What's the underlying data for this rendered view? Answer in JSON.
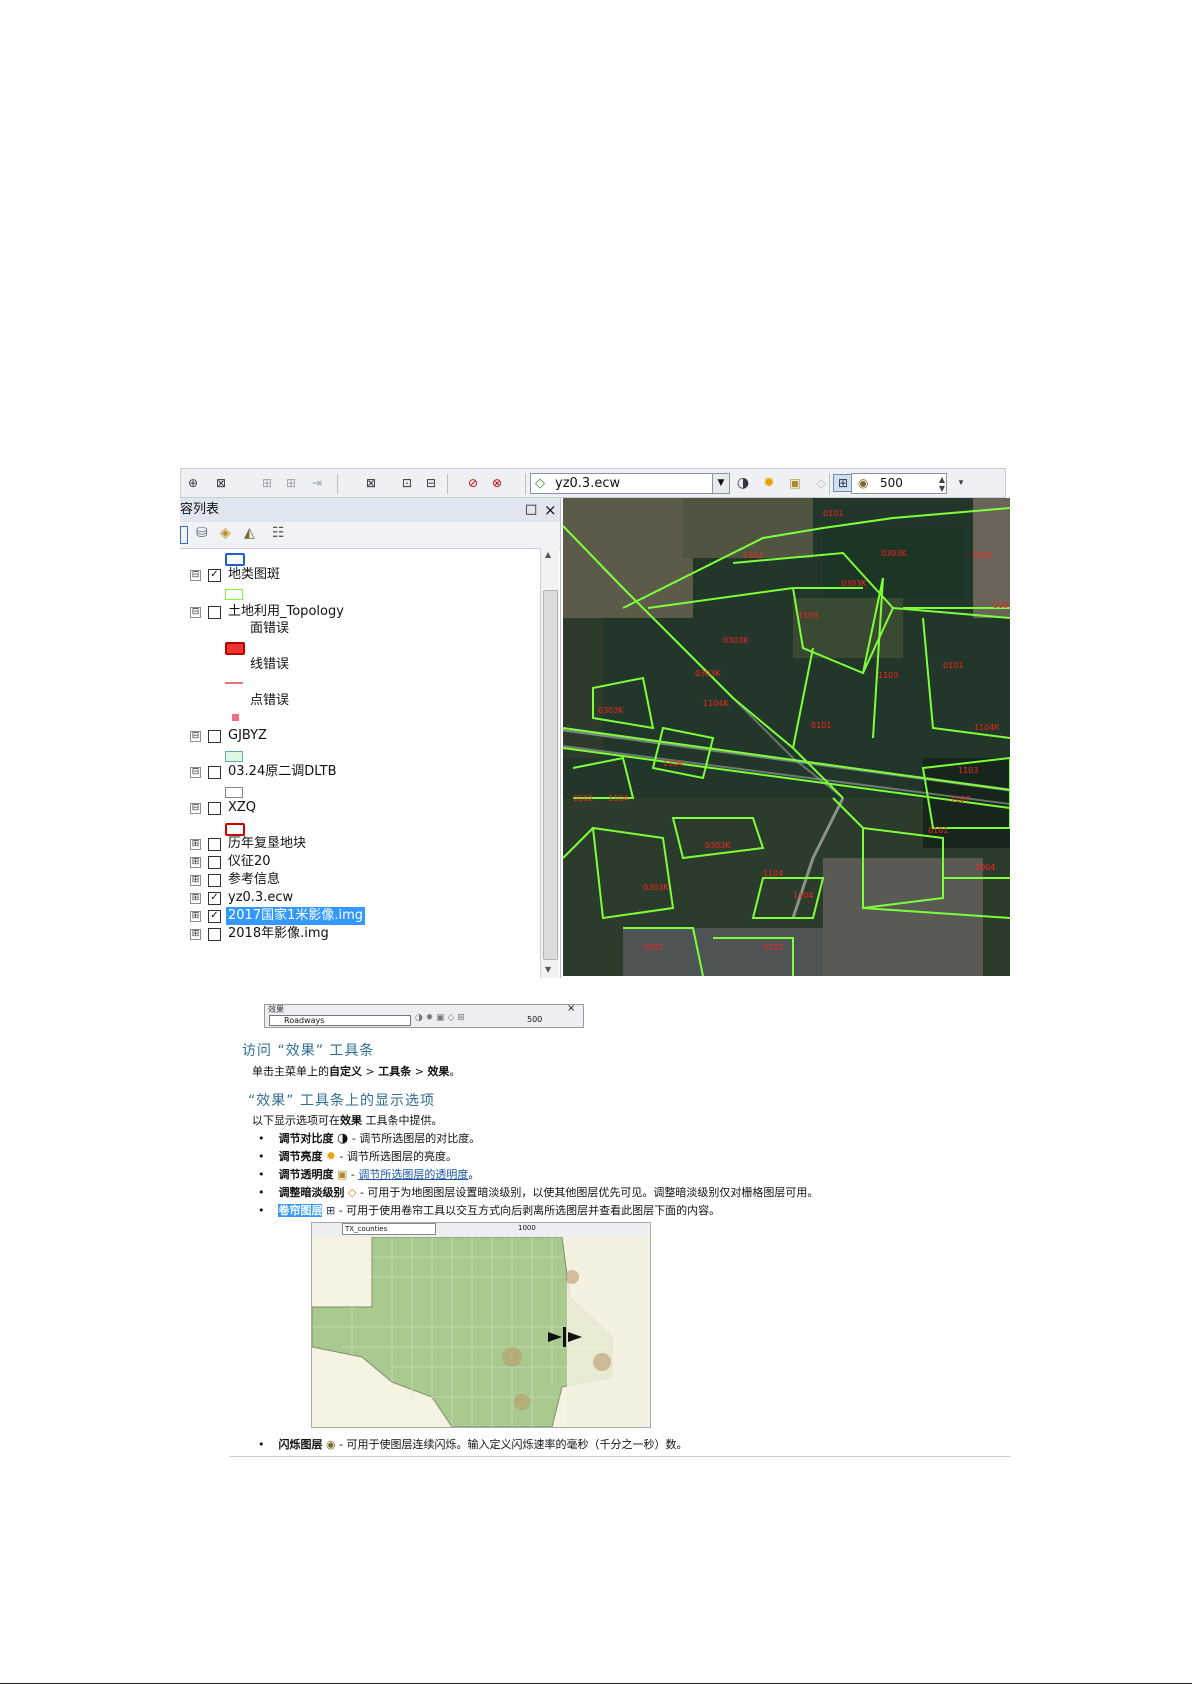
{
  "toolbar": {
    "layer_value": "yz0.3.ecw",
    "flash_rate": "500",
    "icons": [
      "add-data-icon",
      "select-icon",
      "gray-tool-icon",
      "gray-tool-icon",
      "merge-icon",
      "table-icon",
      "identify-icon",
      "report-icon",
      "no-select-icon",
      "clear-icon",
      "contrast-icon",
      "brightness-icon",
      "transparency-icon",
      "dim-icon",
      "swipe-icon",
      "flash-icon"
    ]
  },
  "toc": {
    "title": "容列表",
    "close_label": "×",
    "float_label": "□",
    "layers": [
      {
        "label": "地类图斑",
        "checked": true,
        "expand": "⊟"
      },
      {
        "label": "土地利用_Topology",
        "checked": false,
        "expand": "⊟"
      },
      {
        "label": "面错误"
      },
      {
        "label": "线错误"
      },
      {
        "label": "点错误"
      },
      {
        "label": "GJBYZ",
        "checked": false,
        "expand": "⊟"
      },
      {
        "label": "03.24原二调DLTB",
        "checked": false,
        "expand": "⊟"
      },
      {
        "label": "XZQ",
        "checked": false,
        "expand": "⊟"
      },
      {
        "label": "历年复垦地块",
        "checked": false,
        "expand": "⊞"
      },
      {
        "label": "仪征20",
        "checked": false,
        "expand": "⊞"
      },
      {
        "label": "参考信息",
        "checked": false,
        "expand": "⊞"
      },
      {
        "label": "yz0.3.ecw",
        "checked": true,
        "expand": "⊞"
      },
      {
        "label": "2017国家1米影像.img",
        "checked": true,
        "expand": "⊞",
        "selected": true
      },
      {
        "label": "2018年影像.img",
        "checked": false,
        "expand": "⊞"
      }
    ]
  },
  "map": {
    "parcel_labels": [
      "0101",
      "0303K",
      "1103",
      "0101",
      "0303K",
      "1107",
      "0303K",
      "1103",
      "0303K",
      "0101",
      "1104K",
      "0101",
      "1104K",
      "0303K",
      "1103",
      "1104",
      "1103",
      "0102",
      "0303K",
      "1107",
      "1104",
      "0101",
      "1104",
      "1104",
      "0303K",
      "1004",
      "0201",
      "0102"
    ]
  },
  "doc": {
    "mini_toolbar": {
      "title": "效果",
      "layer": "Roadways",
      "rate": "500"
    },
    "h1": "访问 “效果” 工具条",
    "p1": {
      "a": "单击主菜单上的",
      "b": "自定义",
      "c": " > ",
      "d": "工具条",
      "e": " > ",
      "f": "效果",
      "g": "。"
    },
    "h2": "“效果” 工具条上的显示选项",
    "p2": {
      "a": "以下显示选项可在",
      "b": "效果",
      "c": " 工具条中提供。"
    },
    "bullets": [
      {
        "term": "调节对比度",
        "rest": " - 调节所选图层的对比度。",
        "link": ""
      },
      {
        "term": "调节亮度",
        "rest": " - 调节所选图层的亮度。",
        "link": ""
      },
      {
        "term": "调节透明度",
        "rest": " - ",
        "link": "调节所选图层的透明度",
        "tail": "。"
      },
      {
        "term": "调整暗淡级别",
        "rest": " - 可用于为地图图层设置暗淡级别，以使其他图层优先可见。调整暗淡级别仅对栅格图层可用。",
        "link": ""
      },
      {
        "term": "卷帘图层",
        "rest": " - 可用于使用卷帘工具以交互方式向后剥离所选图层并查看此图层下面的内容。",
        "link": ""
      },
      {
        "term": "闪烁图层",
        "rest": " - 可用于使图层连续闪烁。输入定义闪烁速率的毫秒（千分之一秒）数。",
        "link": ""
      }
    ],
    "texas": {
      "layer": "TX_counties",
      "rate": "1000"
    }
  },
  "colors": {
    "parcel_line": "#7dff3a",
    "parcel_label": "#ff2020",
    "selection": "#3399ff"
  }
}
